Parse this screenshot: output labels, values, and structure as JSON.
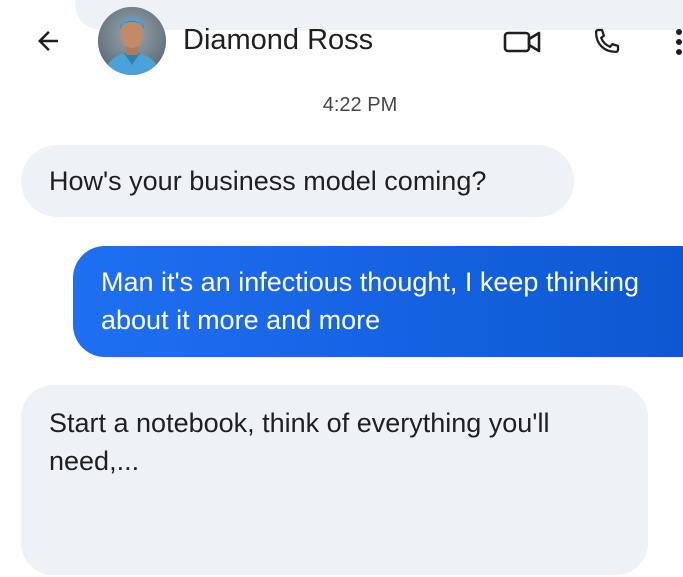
{
  "header": {
    "contact_name": "Diamond Ross",
    "icons": {
      "back": "arrow-back-icon",
      "video": "video-call-icon",
      "phone": "phone-icon",
      "more": "more-vert-icon"
    }
  },
  "conversation": {
    "timestamp": "4:22 PM",
    "messages": [
      {
        "direction": "incoming",
        "text": "How's your business model coming?"
      },
      {
        "direction": "outgoing",
        "text": "Man it's an infectious thought, I keep thinking about it more and more"
      },
      {
        "direction": "incoming",
        "text": "Start a notebook, think of everything you'll need,..."
      }
    ]
  },
  "colors": {
    "incoming_bubble": "#eef1f6",
    "outgoing_bubble": "#0b57d0",
    "text": "#1f1f1f",
    "secondary_text": "#444746"
  }
}
